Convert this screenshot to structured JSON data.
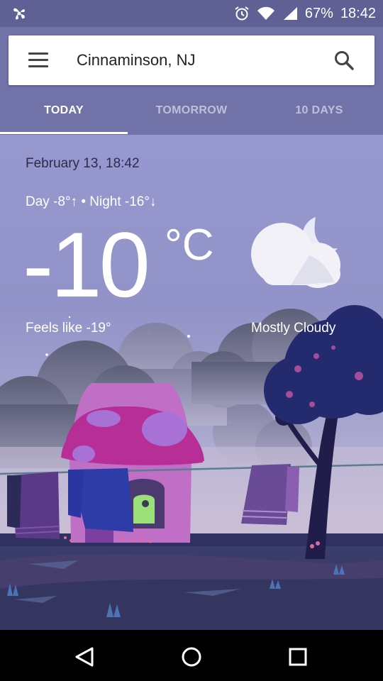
{
  "status_bar": {
    "battery": "67%",
    "time": "18:42",
    "icons": [
      "fan-icon",
      "alarm-icon",
      "wifi-icon",
      "signal-icon"
    ]
  },
  "search": {
    "location": "Cinnaminson, NJ"
  },
  "tabs": [
    {
      "label": "TODAY",
      "active": true
    },
    {
      "label": "TOMORROW",
      "active": false
    },
    {
      "label": "10 DAYS",
      "active": false
    }
  ],
  "weather": {
    "date": "February 13, 18:42",
    "day_night": "Day -8°↑ • Night -16°↓",
    "temperature": "-10",
    "unit": "°C",
    "feels_like": "Feels like -19°",
    "condition": "Mostly Cloudy",
    "icon": "cloud-moon-icon"
  },
  "nav": {
    "icons": [
      "back-icon",
      "home-icon",
      "recents-icon"
    ]
  },
  "colors": {
    "status_bar": "#5f6194",
    "header": "#7172a8",
    "sky": "#9698cf",
    "nav_bar": "#000000"
  }
}
